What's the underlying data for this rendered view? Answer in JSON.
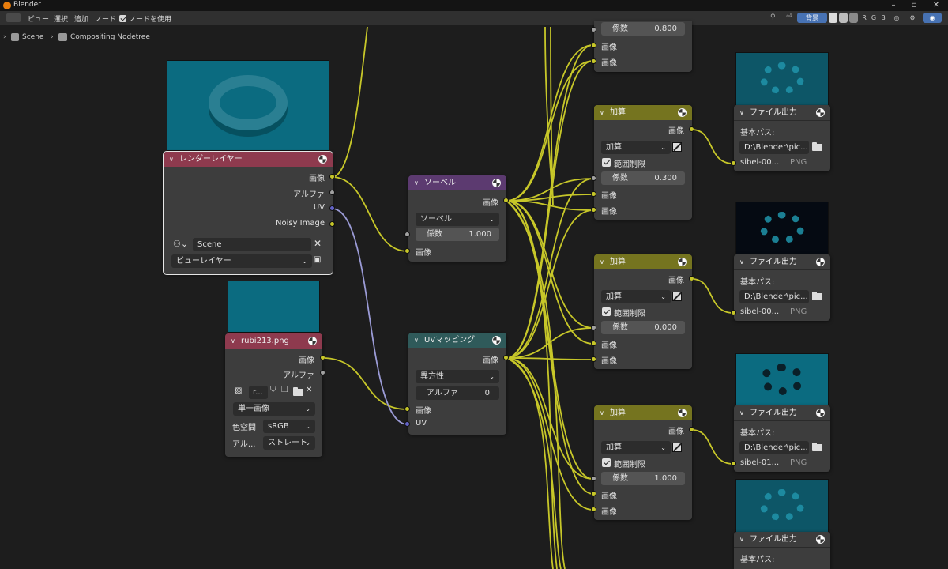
{
  "window": {
    "title": "Blender"
  },
  "header": {
    "menu": [
      "ビュー",
      "選択",
      "追加",
      "ノード"
    ],
    "use_nodes_label": "ノードを使用",
    "backdrop_label": "背景",
    "channels": [
      "R",
      "G",
      "B"
    ]
  },
  "breadcrumb": {
    "scene": "Scene",
    "tree": "Compositing Nodetree"
  },
  "nodes": {
    "render_layers": {
      "title": "レンダーレイヤー",
      "outputs": [
        "画像",
        "アルファ",
        "UV",
        "Noisy Image"
      ],
      "scene": "Scene",
      "view_layer": "ビューレイヤー"
    },
    "image": {
      "title": "rubi213.png",
      "outputs": [
        "画像",
        "アルファ"
      ],
      "image_name": "r...",
      "source": "単一画像",
      "colorspace_label": "色空間",
      "colorspace": "sRGB",
      "alpha_label": "アル...",
      "alpha_mode": "ストレート"
    },
    "sobel": {
      "title": "ソーベル",
      "output": "画像",
      "filter": "ソーベル",
      "factor_label": "係数",
      "factor": "1.000",
      "input": "画像"
    },
    "uv_map": {
      "title": "UVマッピング",
      "output": "画像",
      "filter": "異方性",
      "alpha_label": "アルファ",
      "alpha": "0",
      "inputs": [
        "画像",
        "UV"
      ]
    },
    "add_top": {
      "factor_label": "係数",
      "factor": "0.800",
      "inputs": [
        "画像",
        "画像"
      ]
    },
    "mix": [
      {
        "title": "加算",
        "output": "画像",
        "blend": "加算",
        "clamp_label": "範囲制限",
        "factor_label": "係数",
        "factor": "0.300",
        "inputs": [
          "画像",
          "画像"
        ]
      },
      {
        "title": "加算",
        "output": "画像",
        "blend": "加算",
        "clamp_label": "範囲制限",
        "factor_label": "係数",
        "factor": "0.000",
        "inputs": [
          "画像",
          "画像"
        ]
      },
      {
        "title": "加算",
        "output": "画像",
        "blend": "加算",
        "clamp_label": "範囲制限",
        "factor_label": "係数",
        "factor": "1.000",
        "inputs": [
          "画像",
          "画像"
        ]
      }
    ],
    "file_out": [
      {
        "title": "ファイル出力",
        "base_label": "基本パス:",
        "path": "D:\\Blender\\pic...",
        "slot": "sibel-00...",
        "format": "PNG"
      },
      {
        "title": "ファイル出力",
        "base_label": "基本パス:",
        "path": "D:\\Blender\\pic...",
        "slot": "sibel-00...",
        "format": "PNG"
      },
      {
        "title": "ファイル出力",
        "base_label": "基本パス:",
        "path": "D:\\Blender\\pic...",
        "slot": "sibel-01...",
        "format": "PNG"
      },
      {
        "title": "ファイル出力",
        "base_label": "基本パス:"
      }
    ]
  },
  "colors": {
    "render_header": "#8e3a4e",
    "image_header": "#8e3a4e",
    "filter_header": "#5c3a70",
    "distort_header": "#2f5a5a",
    "color_header": "#75741f",
    "output_header": "#3d3d3d",
    "wire_color": "#c7c729",
    "uv_wire": "#9b9bd6"
  }
}
